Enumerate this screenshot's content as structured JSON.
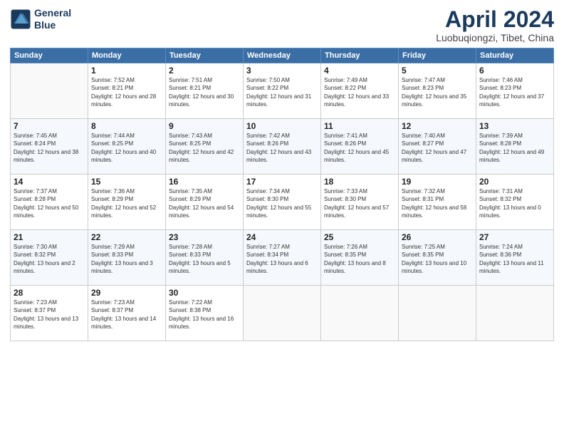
{
  "logo": {
    "line1": "General",
    "line2": "Blue"
  },
  "title": "April 2024",
  "subtitle": "Luobuqiongzi, Tibet, China",
  "weekdays": [
    "Sunday",
    "Monday",
    "Tuesday",
    "Wednesday",
    "Thursday",
    "Friday",
    "Saturday"
  ],
  "weeks": [
    [
      {
        "day": "",
        "sunrise": "",
        "sunset": "",
        "daylight": ""
      },
      {
        "day": "1",
        "sunrise": "Sunrise: 7:52 AM",
        "sunset": "Sunset: 8:21 PM",
        "daylight": "Daylight: 12 hours and 28 minutes."
      },
      {
        "day": "2",
        "sunrise": "Sunrise: 7:51 AM",
        "sunset": "Sunset: 8:21 PM",
        "daylight": "Daylight: 12 hours and 30 minutes."
      },
      {
        "day": "3",
        "sunrise": "Sunrise: 7:50 AM",
        "sunset": "Sunset: 8:22 PM",
        "daylight": "Daylight: 12 hours and 31 minutes."
      },
      {
        "day": "4",
        "sunrise": "Sunrise: 7:49 AM",
        "sunset": "Sunset: 8:22 PM",
        "daylight": "Daylight: 12 hours and 33 minutes."
      },
      {
        "day": "5",
        "sunrise": "Sunrise: 7:47 AM",
        "sunset": "Sunset: 8:23 PM",
        "daylight": "Daylight: 12 hours and 35 minutes."
      },
      {
        "day": "6",
        "sunrise": "Sunrise: 7:46 AM",
        "sunset": "Sunset: 8:23 PM",
        "daylight": "Daylight: 12 hours and 37 minutes."
      }
    ],
    [
      {
        "day": "7",
        "sunrise": "Sunrise: 7:45 AM",
        "sunset": "Sunset: 8:24 PM",
        "daylight": "Daylight: 12 hours and 38 minutes."
      },
      {
        "day": "8",
        "sunrise": "Sunrise: 7:44 AM",
        "sunset": "Sunset: 8:25 PM",
        "daylight": "Daylight: 12 hours and 40 minutes."
      },
      {
        "day": "9",
        "sunrise": "Sunrise: 7:43 AM",
        "sunset": "Sunset: 8:25 PM",
        "daylight": "Daylight: 12 hours and 42 minutes."
      },
      {
        "day": "10",
        "sunrise": "Sunrise: 7:42 AM",
        "sunset": "Sunset: 8:26 PM",
        "daylight": "Daylight: 12 hours and 43 minutes."
      },
      {
        "day": "11",
        "sunrise": "Sunrise: 7:41 AM",
        "sunset": "Sunset: 8:26 PM",
        "daylight": "Daylight: 12 hours and 45 minutes."
      },
      {
        "day": "12",
        "sunrise": "Sunrise: 7:40 AM",
        "sunset": "Sunset: 8:27 PM",
        "daylight": "Daylight: 12 hours and 47 minutes."
      },
      {
        "day": "13",
        "sunrise": "Sunrise: 7:39 AM",
        "sunset": "Sunset: 8:28 PM",
        "daylight": "Daylight: 12 hours and 49 minutes."
      }
    ],
    [
      {
        "day": "14",
        "sunrise": "Sunrise: 7:37 AM",
        "sunset": "Sunset: 8:28 PM",
        "daylight": "Daylight: 12 hours and 50 minutes."
      },
      {
        "day": "15",
        "sunrise": "Sunrise: 7:36 AM",
        "sunset": "Sunset: 8:29 PM",
        "daylight": "Daylight: 12 hours and 52 minutes."
      },
      {
        "day": "16",
        "sunrise": "Sunrise: 7:35 AM",
        "sunset": "Sunset: 8:29 PM",
        "daylight": "Daylight: 12 hours and 54 minutes."
      },
      {
        "day": "17",
        "sunrise": "Sunrise: 7:34 AM",
        "sunset": "Sunset: 8:30 PM",
        "daylight": "Daylight: 12 hours and 55 minutes."
      },
      {
        "day": "18",
        "sunrise": "Sunrise: 7:33 AM",
        "sunset": "Sunset: 8:30 PM",
        "daylight": "Daylight: 12 hours and 57 minutes."
      },
      {
        "day": "19",
        "sunrise": "Sunrise: 7:32 AM",
        "sunset": "Sunset: 8:31 PM",
        "daylight": "Daylight: 12 hours and 58 minutes."
      },
      {
        "day": "20",
        "sunrise": "Sunrise: 7:31 AM",
        "sunset": "Sunset: 8:32 PM",
        "daylight": "Daylight: 13 hours and 0 minutes."
      }
    ],
    [
      {
        "day": "21",
        "sunrise": "Sunrise: 7:30 AM",
        "sunset": "Sunset: 8:32 PM",
        "daylight": "Daylight: 13 hours and 2 minutes."
      },
      {
        "day": "22",
        "sunrise": "Sunrise: 7:29 AM",
        "sunset": "Sunset: 8:33 PM",
        "daylight": "Daylight: 13 hours and 3 minutes."
      },
      {
        "day": "23",
        "sunrise": "Sunrise: 7:28 AM",
        "sunset": "Sunset: 8:33 PM",
        "daylight": "Daylight: 13 hours and 5 minutes."
      },
      {
        "day": "24",
        "sunrise": "Sunrise: 7:27 AM",
        "sunset": "Sunset: 8:34 PM",
        "daylight": "Daylight: 13 hours and 6 minutes."
      },
      {
        "day": "25",
        "sunrise": "Sunrise: 7:26 AM",
        "sunset": "Sunset: 8:35 PM",
        "daylight": "Daylight: 13 hours and 8 minutes."
      },
      {
        "day": "26",
        "sunrise": "Sunrise: 7:25 AM",
        "sunset": "Sunset: 8:35 PM",
        "daylight": "Daylight: 13 hours and 10 minutes."
      },
      {
        "day": "27",
        "sunrise": "Sunrise: 7:24 AM",
        "sunset": "Sunset: 8:36 PM",
        "daylight": "Daylight: 13 hours and 11 minutes."
      }
    ],
    [
      {
        "day": "28",
        "sunrise": "Sunrise: 7:23 AM",
        "sunset": "Sunset: 8:37 PM",
        "daylight": "Daylight: 13 hours and 13 minutes."
      },
      {
        "day": "29",
        "sunrise": "Sunrise: 7:23 AM",
        "sunset": "Sunset: 8:37 PM",
        "daylight": "Daylight: 13 hours and 14 minutes."
      },
      {
        "day": "30",
        "sunrise": "Sunrise: 7:22 AM",
        "sunset": "Sunset: 8:38 PM",
        "daylight": "Daylight: 13 hours and 16 minutes."
      },
      {
        "day": "",
        "sunrise": "",
        "sunset": "",
        "daylight": ""
      },
      {
        "day": "",
        "sunrise": "",
        "sunset": "",
        "daylight": ""
      },
      {
        "day": "",
        "sunrise": "",
        "sunset": "",
        "daylight": ""
      },
      {
        "day": "",
        "sunrise": "",
        "sunset": "",
        "daylight": ""
      }
    ]
  ]
}
